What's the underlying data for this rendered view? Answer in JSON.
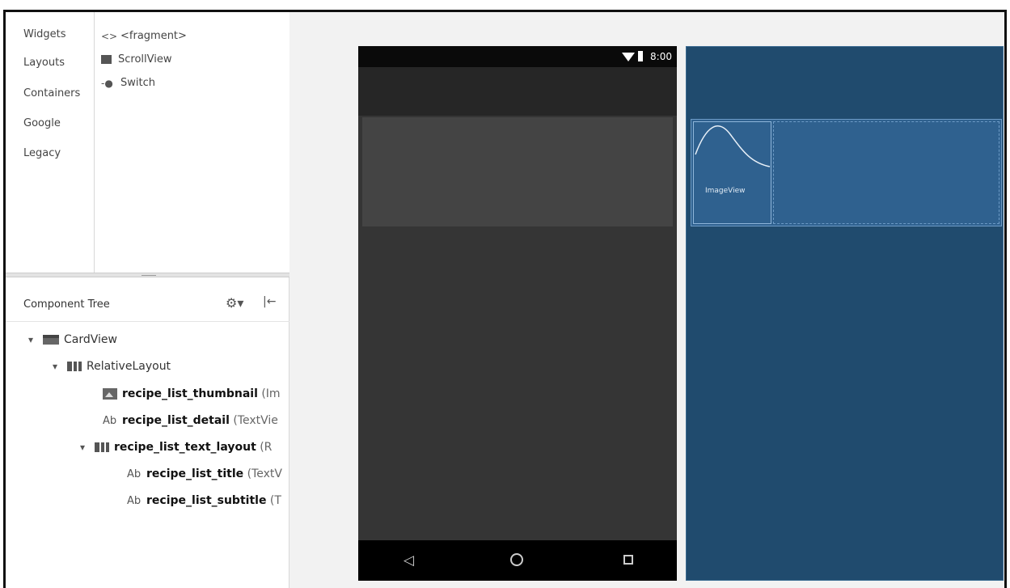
{
  "palette": {
    "categories": [
      "Widgets",
      "Layouts",
      "Containers",
      "Google",
      "Legacy"
    ],
    "items": [
      {
        "icon": "fragment-icon",
        "glyph": "<>",
        "label": "<fragment>"
      },
      {
        "icon": "scrollview-icon",
        "glyph": "",
        "label": "ScrollView"
      },
      {
        "icon": "switch-icon",
        "glyph": "-●",
        "label": "Switch"
      }
    ]
  },
  "component_tree": {
    "title": "Component Tree",
    "nodes": [
      {
        "name": "CardView",
        "type": ""
      },
      {
        "name": "RelativeLayout",
        "type": ""
      },
      {
        "name": "recipe_list_thumbnail",
        "type": "(Im"
      },
      {
        "name": "recipe_list_detail",
        "type": "(TextVie"
      },
      {
        "name": "recipe_list_text_layout",
        "type": "(R"
      },
      {
        "name": "recipe_list_title",
        "type": "(TextV"
      },
      {
        "name": "recipe_list_subtitle",
        "type": "(T"
      }
    ]
  },
  "device": {
    "status_time": "8:00"
  },
  "blueprint": {
    "image_label": "ImageView"
  },
  "colors": {
    "blueprint_bg": "#204b6e",
    "phone_bg": "#353535"
  }
}
